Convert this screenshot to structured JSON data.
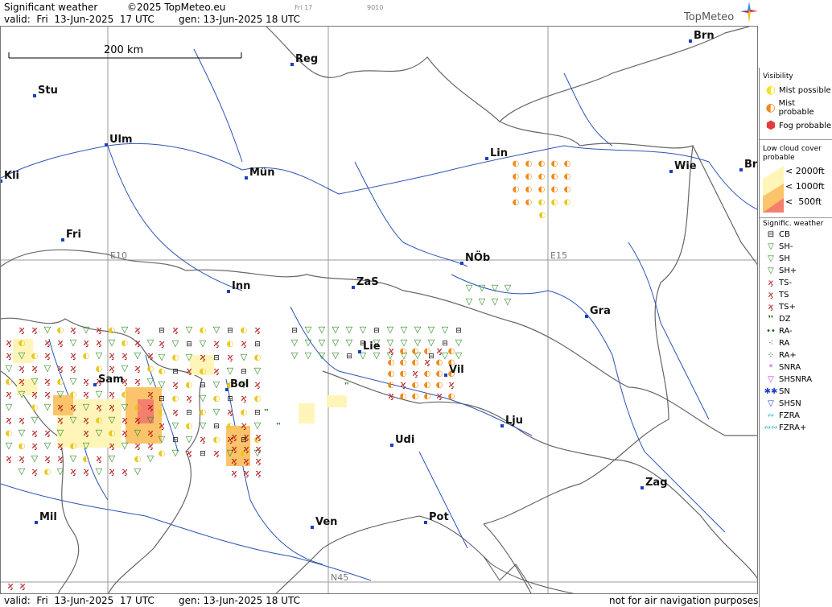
{
  "header": {
    "title": "Significant weather",
    "copyright": "©2025 TopMeteo.eu",
    "valid": "valid:  Fri  13-Jun-2025  17 UTC",
    "gen": "gen: 13-Jun-2025 18 UTC",
    "tiny1": "Fri 17",
    "tiny2": "9010",
    "logo": "TopMeteo"
  },
  "scale": {
    "label": "200 km"
  },
  "grid_labels": {
    "e10": "E10",
    "e15": "E15",
    "n45": "N45"
  },
  "cities": [
    {
      "name": "Brn"
    },
    {
      "name": "Reg"
    },
    {
      "name": "Stu"
    },
    {
      "name": "Ulm"
    },
    {
      "name": "Lin"
    },
    {
      "name": "Kli"
    },
    {
      "name": "Mün"
    },
    {
      "name": "Wie"
    },
    {
      "name": "Br"
    },
    {
      "name": "Fri"
    },
    {
      "name": "NÖb"
    },
    {
      "name": "Inn"
    },
    {
      "name": "ZaS"
    },
    {
      "name": "Gra"
    },
    {
      "name": "Lie"
    },
    {
      "name": "Vil"
    },
    {
      "name": "Sam"
    },
    {
      "name": "Bol"
    },
    {
      "name": "Lju"
    },
    {
      "name": "Udi"
    },
    {
      "name": "Zag"
    },
    {
      "name": "Mil"
    },
    {
      "name": "Pot"
    },
    {
      "name": "Ven"
    }
  ],
  "legend": {
    "visibility_title": "Visibility",
    "visibility": [
      {
        "label": "Mist possible",
        "color": "#f7e21a"
      },
      {
        "label": "Mist probable",
        "color": "#f08a1c"
      },
      {
        "label": "Fog probable",
        "color": "#e23b3b"
      }
    ],
    "cloud_title": "Low cloud cover probable",
    "cloud": [
      {
        "label": "< 2000ft",
        "color": "#fff5b8"
      },
      {
        "label": "< 1000ft",
        "color": "#fcc46a"
      },
      {
        "label": "<  500ft",
        "color": "#f47f6f"
      }
    ],
    "sigwx_title": "Signific. weather",
    "sigwx": [
      {
        "label": "CB",
        "symbol": "⊟",
        "color": "#000"
      },
      {
        "label": "SH-",
        "symbol": "▽",
        "color": "#2b8a1f"
      },
      {
        "label": "SH",
        "symbol": "▽",
        "color": "#2b8a1f"
      },
      {
        "label": "SH+",
        "symbol": "▽",
        "color": "#2b8a1f"
      },
      {
        "label": "TS-",
        "symbol": "ϗ",
        "color": "#b01010"
      },
      {
        "label": "TS",
        "symbol": "ϗ",
        "color": "#b01010"
      },
      {
        "label": "TS+",
        "symbol": "ϗ",
        "color": "#b01010"
      },
      {
        "label": "DZ",
        "symbol": "❜❜",
        "color": "#145e14"
      },
      {
        "label": "RA-",
        "symbol": "••",
        "color": "#145e14"
      },
      {
        "label": "RA",
        "symbol": "⁖",
        "color": "#145e14"
      },
      {
        "label": "RA+",
        "symbol": "⁘",
        "color": "#145e14"
      },
      {
        "label": "SNRA",
        "symbol": "*",
        "color": "#c23bd6"
      },
      {
        "label": "SHSNRA",
        "symbol": "▽",
        "color": "#c23bd6"
      },
      {
        "label": "SN",
        "symbol": "✱✱",
        "color": "#2040d0"
      },
      {
        "label": "SHSN",
        "symbol": "▽",
        "color": "#2040d0"
      },
      {
        "label": "FZRA",
        "symbol": "∾",
        "color": "#1ab0d0"
      },
      {
        "label": "FZRA+",
        "symbol": "∾∾",
        "color": "#1ab0d0"
      }
    ]
  },
  "footer": {
    "valid": "valid:  Fri  13-Jun-2025  17 UTC",
    "gen": "gen: 13-Jun-2025 18 UTC",
    "note": "not for air navigation purposes"
  }
}
